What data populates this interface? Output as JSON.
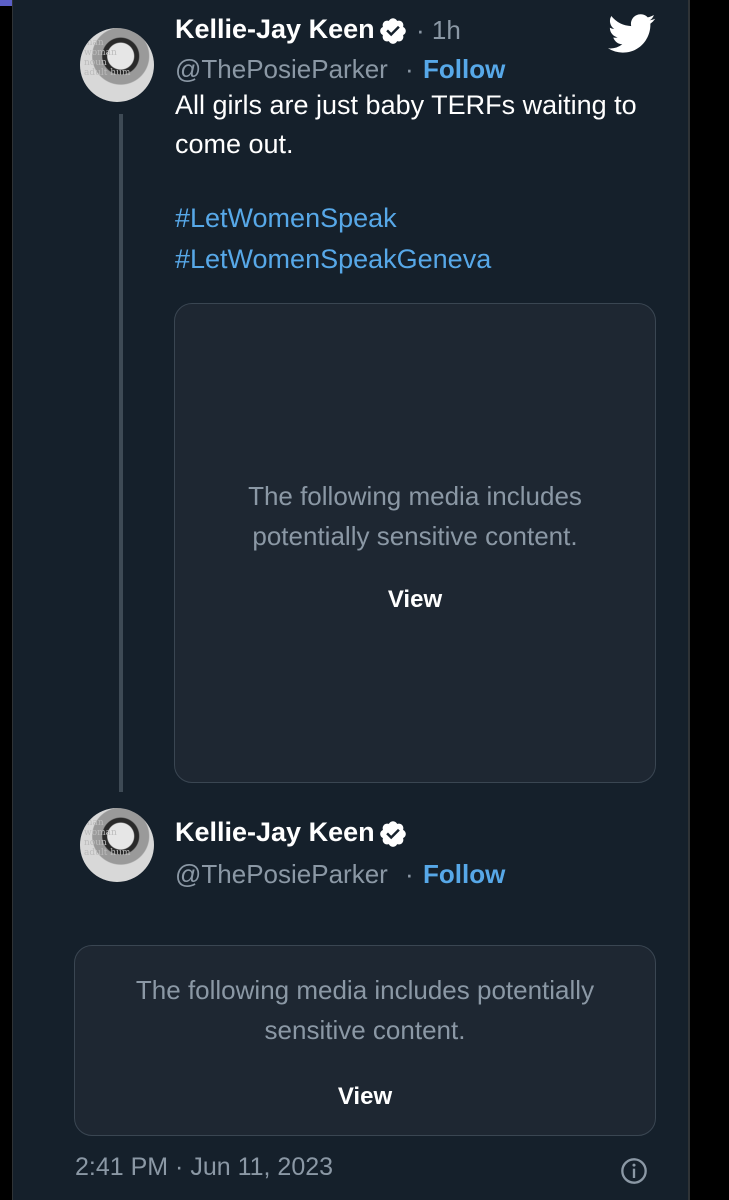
{
  "tweet1": {
    "author_name": "Kellie-Jay Keen",
    "time": "· 1h",
    "handle": "@ThePosieParker",
    "separator": "·",
    "follow_label": "Follow",
    "text": "All girls are just baby TERFs waiting to come out.",
    "hashtags": [
      "#LetWomenSpeak",
      "#LetWomenSpeakGeneva"
    ],
    "media_warning": "The following media includes potentially sensitive content.",
    "media_view_label": "View"
  },
  "tweet2": {
    "author_name": "Kellie-Jay Keen",
    "handle": "@ThePosieParker",
    "separator": "·",
    "follow_label": "Follow",
    "media_warning": "The following media includes potentially sensitive content.",
    "media_view_label": "View"
  },
  "footer": {
    "timestamp": "2:41 PM · Jun 11, 2023"
  },
  "icons": {
    "verified": "verified-badge-icon",
    "twitter": "twitter-bird-icon",
    "info": "info-icon"
  },
  "colors": {
    "background": "#15202b",
    "link": "#57a8e8",
    "muted": "#8b98a5",
    "media_bg": "#1e2732"
  }
}
